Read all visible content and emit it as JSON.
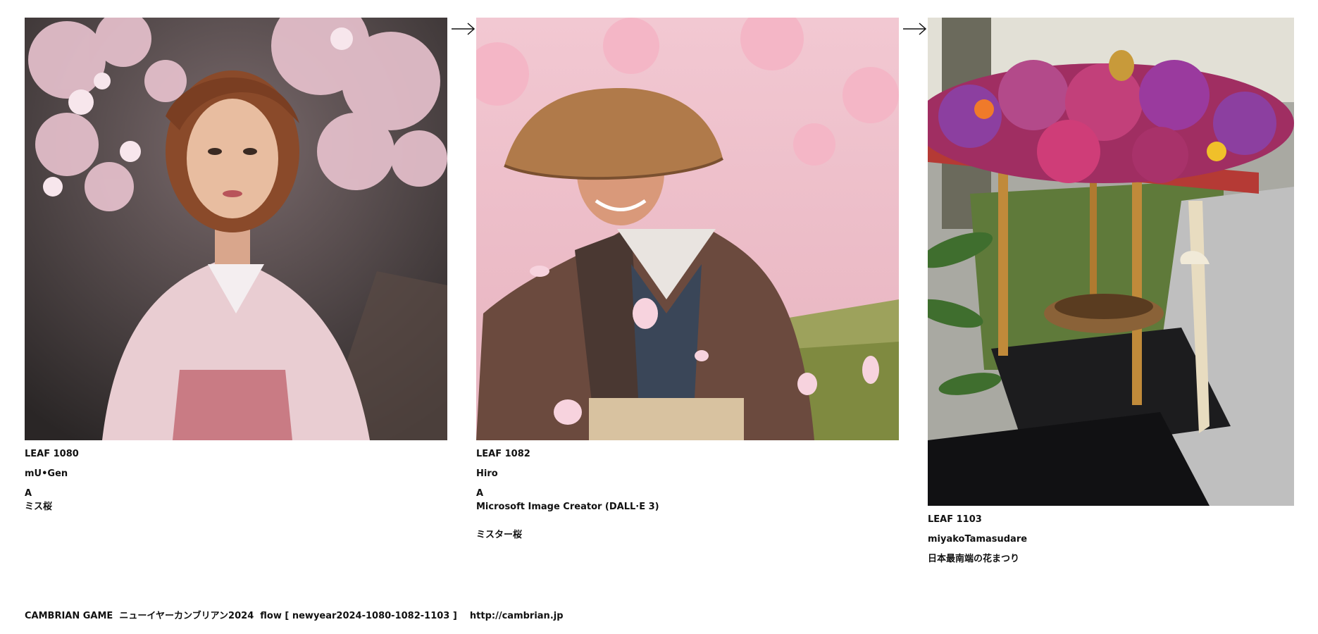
{
  "leaves": [
    {
      "id_label": "LEAF 1080",
      "author": "mU•Gen",
      "title": "A",
      "subtitle": "ミス桜",
      "photo_icon": "portrait-woman-kimono-cherry-blossoms"
    },
    {
      "id_label": "LEAF 1082",
      "author": "Hiro",
      "title": "A",
      "tool": "Microsoft Image Creator (DALL·E 3)",
      "subtitle": "ミスター桜",
      "photo_icon": "portrait-elderly-man-straw-hat-cherry-blossoms"
    },
    {
      "id_label": "LEAF 1103",
      "author": "miyakoTamasudare",
      "subtitle": "日本最南端の花まつり",
      "photo_icon": "flower-shrine-hanamatsuri"
    }
  ],
  "flow_arrows": [
    "arrow-right-icon",
    "arrow-right-icon"
  ],
  "footer": {
    "text": "CAMBRIAN GAME  ニューイヤーカンブリアン2024  flow [ newyear2024-1080-1082-1103 ]    http://cambrian.jp"
  },
  "colors": {
    "text": "#111111",
    "background": "#ffffff",
    "blossom_pink": "#e8a9bd",
    "kimono_pink": "#d98b9a"
  }
}
